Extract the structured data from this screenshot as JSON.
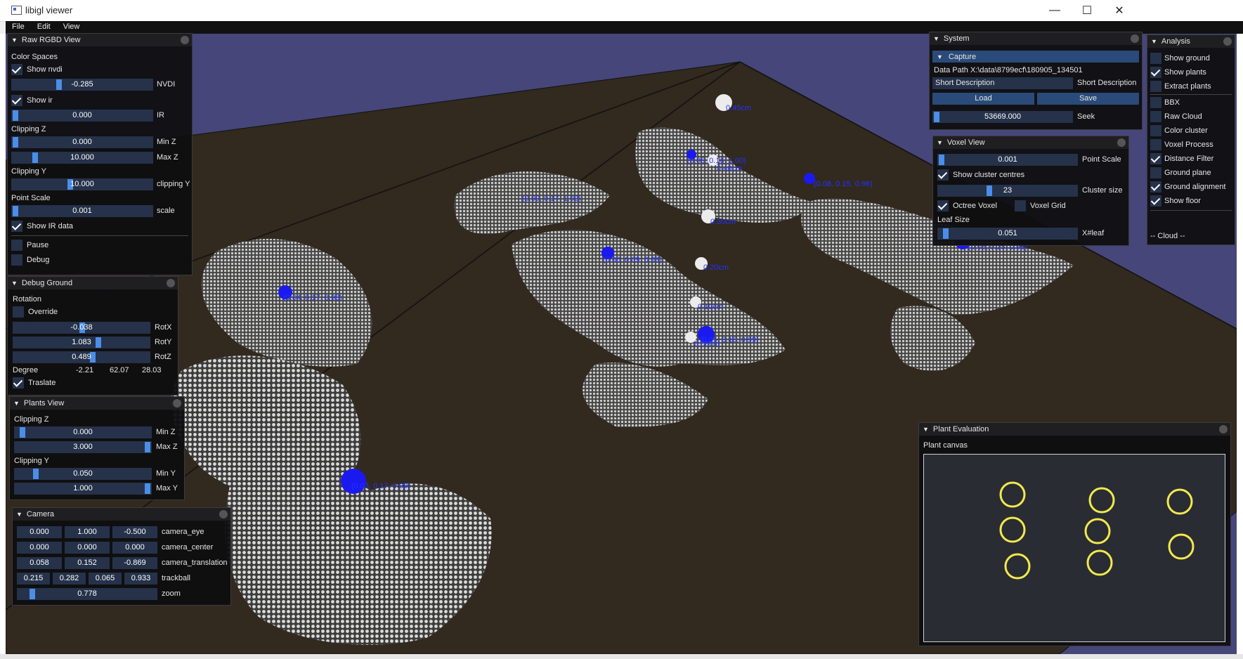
{
  "window": {
    "title": "libigl viewer",
    "minimize": "—",
    "maximize": "☐",
    "close": "✕"
  },
  "menu": [
    "File",
    "Edit",
    "View"
  ],
  "raw_rgbd": {
    "title": "Raw RGBD View",
    "color_spaces": "Color Spaces",
    "show_nvdi": "Show nvdi",
    "nvdi_value": "-0.285",
    "nvdi_label": "NVDI",
    "show_ir": "Show ir",
    "ir_value": "0.000",
    "ir_label": "IR",
    "clipping_z": "Clipping Z",
    "min_z_value": "0.000",
    "min_z_label": "Min Z",
    "max_z_value": "10.000",
    "max_z_label": "Max Z",
    "clipping_y": "Clipping Y",
    "clip_y_value": "10.000",
    "clip_y_label": "clipping Y",
    "point_scale": "Point Scale",
    "scale_value": "0.001",
    "scale_label": "scale",
    "show_ir_data": "Show IR data",
    "pause": "Pause",
    "debug": "Debug"
  },
  "debug_ground": {
    "title": "Debug Ground",
    "rotation": "Rotation",
    "override": "Override",
    "rotx_value": "-0.038",
    "rotx_label": "RotX",
    "roty_value": "1.083",
    "roty_label": "RotY",
    "rotz_value": "0.489",
    "rotz_label": "RotZ",
    "degree": "Degree",
    "deg1": "-2.21",
    "deg2": "62.07",
    "deg3": "28.03",
    "traslate": "Traslate"
  },
  "plants_view": {
    "title": "Plants View",
    "clipping_z": "Clipping Z",
    "min_z_value": "0.000",
    "min_z_label": "Min Z",
    "max_z_value": "3.000",
    "max_z_label": "Max Z",
    "clipping_y": "Clipping Y",
    "min_y_value": "0.050",
    "min_y_label": "Min Y",
    "max_y_value": "1.000",
    "max_y_label": "Max Y"
  },
  "camera": {
    "title": "Camera",
    "eye": [
      "0.000",
      "1.000",
      "-0.500"
    ],
    "eye_label": "camera_eye",
    "center": [
      "0.000",
      "0.000",
      "0.000"
    ],
    "center_label": "camera_center",
    "translation": [
      "0.058",
      "0.152",
      "-0.869"
    ],
    "translation_label": "camera_translation",
    "trackball": [
      "0.215",
      "0.282",
      "0.065",
      "0.933"
    ],
    "trackball_label": "trackball",
    "zoom_value": "0.778",
    "zoom_label": "zoom"
  },
  "system": {
    "title": "System",
    "capture": "Capture",
    "data_path": "Data Path X:\\data\\8799ecf\\180905_134501",
    "short_desc_value": "Short Description",
    "short_desc_label": "Short Description",
    "load": "Load",
    "save": "Save",
    "seek_value": "53669.000",
    "seek_label": "Seek"
  },
  "voxel_view": {
    "title": "Voxel View",
    "point_scale_value": "0.001",
    "point_scale_label": "Point Scale",
    "show_cluster_centres": "Show cluster centres",
    "cluster_size_value": "23",
    "cluster_size_label": "Cluster size",
    "octree_voxel": "Octree Voxel",
    "voxel_grid": "Voxel Grid",
    "leaf_size": "Leaf Size",
    "leaf_value": "0.051",
    "leaf_label": "X#leaf"
  },
  "analysis": {
    "title": "Analysis",
    "items": [
      {
        "label": "Show ground",
        "checked": false
      },
      {
        "label": "Show plants",
        "checked": true
      },
      {
        "label": "Extract plants",
        "checked": false
      },
      {
        "label": "BBX",
        "checked": false
      },
      {
        "label": "Raw Cloud",
        "checked": false
      },
      {
        "label": "Color cluster",
        "checked": false
      },
      {
        "label": "Voxel Process",
        "checked": false
      },
      {
        "label": "Distance Filter",
        "checked": true
      },
      {
        "label": "Ground plane",
        "checked": false
      },
      {
        "label": "Ground alignment",
        "checked": true
      },
      {
        "label": "Show floor",
        "checked": true
      }
    ],
    "cloud": "-- Cloud --"
  },
  "plant_eval": {
    "title": "Plant Evaluation",
    "canvas_label": "Plant canvas",
    "ring_color": "#f2e94e"
  },
  "scene_labels": [
    "(0.09, 0.17, 1.02)",
    "(0.05, 0.16, 1.00)",
    "(0.06, 0.09, 0.69)",
    "(0.08, 0.15, 0.96)",
    "(0.05, 0.15, 0.98)",
    "(0.04, 0.17, 0.98)",
    "(0.05, 0.16, 0.99)",
    "(0.03, 0.17, 0.99)",
    "0.45cm",
    "0.40cm",
    "0.30cm",
    "0.20cm",
    "0.10cm",
    "0.08cm"
  ]
}
